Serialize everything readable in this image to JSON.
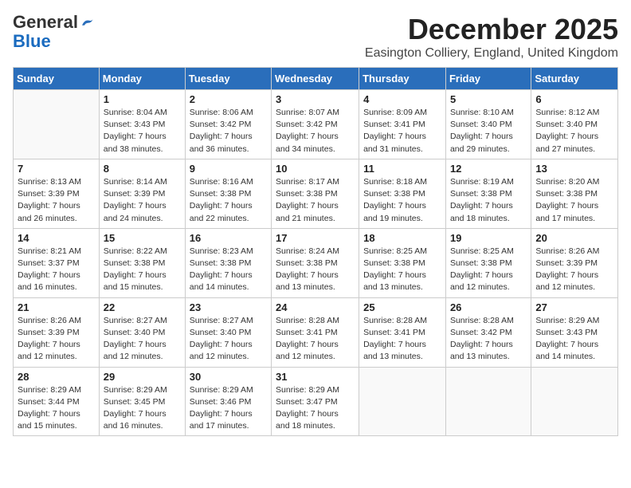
{
  "header": {
    "logo_general": "General",
    "logo_blue": "Blue",
    "month_title": "December 2025",
    "location": "Easington Colliery, England, United Kingdom"
  },
  "days_of_week": [
    "Sunday",
    "Monday",
    "Tuesday",
    "Wednesday",
    "Thursday",
    "Friday",
    "Saturday"
  ],
  "weeks": [
    [
      {
        "day": "",
        "info": ""
      },
      {
        "day": "1",
        "info": "Sunrise: 8:04 AM\nSunset: 3:43 PM\nDaylight: 7 hours\nand 38 minutes."
      },
      {
        "day": "2",
        "info": "Sunrise: 8:06 AM\nSunset: 3:42 PM\nDaylight: 7 hours\nand 36 minutes."
      },
      {
        "day": "3",
        "info": "Sunrise: 8:07 AM\nSunset: 3:42 PM\nDaylight: 7 hours\nand 34 minutes."
      },
      {
        "day": "4",
        "info": "Sunrise: 8:09 AM\nSunset: 3:41 PM\nDaylight: 7 hours\nand 31 minutes."
      },
      {
        "day": "5",
        "info": "Sunrise: 8:10 AM\nSunset: 3:40 PM\nDaylight: 7 hours\nand 29 minutes."
      },
      {
        "day": "6",
        "info": "Sunrise: 8:12 AM\nSunset: 3:40 PM\nDaylight: 7 hours\nand 27 minutes."
      }
    ],
    [
      {
        "day": "7",
        "info": "Sunrise: 8:13 AM\nSunset: 3:39 PM\nDaylight: 7 hours\nand 26 minutes."
      },
      {
        "day": "8",
        "info": "Sunrise: 8:14 AM\nSunset: 3:39 PM\nDaylight: 7 hours\nand 24 minutes."
      },
      {
        "day": "9",
        "info": "Sunrise: 8:16 AM\nSunset: 3:38 PM\nDaylight: 7 hours\nand 22 minutes."
      },
      {
        "day": "10",
        "info": "Sunrise: 8:17 AM\nSunset: 3:38 PM\nDaylight: 7 hours\nand 21 minutes."
      },
      {
        "day": "11",
        "info": "Sunrise: 8:18 AM\nSunset: 3:38 PM\nDaylight: 7 hours\nand 19 minutes."
      },
      {
        "day": "12",
        "info": "Sunrise: 8:19 AM\nSunset: 3:38 PM\nDaylight: 7 hours\nand 18 minutes."
      },
      {
        "day": "13",
        "info": "Sunrise: 8:20 AM\nSunset: 3:38 PM\nDaylight: 7 hours\nand 17 minutes."
      }
    ],
    [
      {
        "day": "14",
        "info": "Sunrise: 8:21 AM\nSunset: 3:37 PM\nDaylight: 7 hours\nand 16 minutes."
      },
      {
        "day": "15",
        "info": "Sunrise: 8:22 AM\nSunset: 3:38 PM\nDaylight: 7 hours\nand 15 minutes."
      },
      {
        "day": "16",
        "info": "Sunrise: 8:23 AM\nSunset: 3:38 PM\nDaylight: 7 hours\nand 14 minutes."
      },
      {
        "day": "17",
        "info": "Sunrise: 8:24 AM\nSunset: 3:38 PM\nDaylight: 7 hours\nand 13 minutes."
      },
      {
        "day": "18",
        "info": "Sunrise: 8:25 AM\nSunset: 3:38 PM\nDaylight: 7 hours\nand 13 minutes."
      },
      {
        "day": "19",
        "info": "Sunrise: 8:25 AM\nSunset: 3:38 PM\nDaylight: 7 hours\nand 12 minutes."
      },
      {
        "day": "20",
        "info": "Sunrise: 8:26 AM\nSunset: 3:39 PM\nDaylight: 7 hours\nand 12 minutes."
      }
    ],
    [
      {
        "day": "21",
        "info": "Sunrise: 8:26 AM\nSunset: 3:39 PM\nDaylight: 7 hours\nand 12 minutes."
      },
      {
        "day": "22",
        "info": "Sunrise: 8:27 AM\nSunset: 3:40 PM\nDaylight: 7 hours\nand 12 minutes."
      },
      {
        "day": "23",
        "info": "Sunrise: 8:27 AM\nSunset: 3:40 PM\nDaylight: 7 hours\nand 12 minutes."
      },
      {
        "day": "24",
        "info": "Sunrise: 8:28 AM\nSunset: 3:41 PM\nDaylight: 7 hours\nand 12 minutes."
      },
      {
        "day": "25",
        "info": "Sunrise: 8:28 AM\nSunset: 3:41 PM\nDaylight: 7 hours\nand 13 minutes."
      },
      {
        "day": "26",
        "info": "Sunrise: 8:28 AM\nSunset: 3:42 PM\nDaylight: 7 hours\nand 13 minutes."
      },
      {
        "day": "27",
        "info": "Sunrise: 8:29 AM\nSunset: 3:43 PM\nDaylight: 7 hours\nand 14 minutes."
      }
    ],
    [
      {
        "day": "28",
        "info": "Sunrise: 8:29 AM\nSunset: 3:44 PM\nDaylight: 7 hours\nand 15 minutes."
      },
      {
        "day": "29",
        "info": "Sunrise: 8:29 AM\nSunset: 3:45 PM\nDaylight: 7 hours\nand 16 minutes."
      },
      {
        "day": "30",
        "info": "Sunrise: 8:29 AM\nSunset: 3:46 PM\nDaylight: 7 hours\nand 17 minutes."
      },
      {
        "day": "31",
        "info": "Sunrise: 8:29 AM\nSunset: 3:47 PM\nDaylight: 7 hours\nand 18 minutes."
      },
      {
        "day": "",
        "info": ""
      },
      {
        "day": "",
        "info": ""
      },
      {
        "day": "",
        "info": ""
      }
    ]
  ]
}
